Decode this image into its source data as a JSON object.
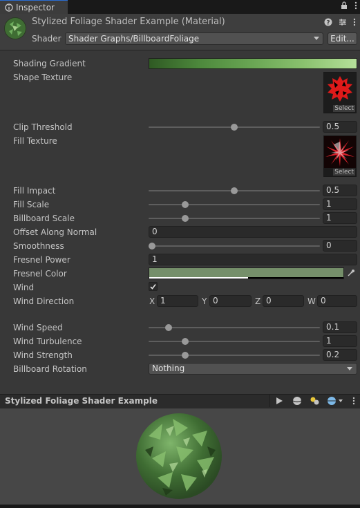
{
  "tab": {
    "title": "Inspector"
  },
  "header": {
    "title": "Stylized Foliage Shader Example (Material)",
    "shader_label": "Shader",
    "shader_value": "Shader Graphs/BillboardFoliage",
    "edit_label": "Edit..."
  },
  "props": {
    "shading_gradient": "Shading Gradient",
    "shape_texture": "Shape Texture",
    "clip_threshold": "Clip Threshold",
    "clip_threshold_value": "0.5",
    "fill_texture": "Fill Texture",
    "fill_impact": "Fill Impact",
    "fill_impact_value": "0.5",
    "fill_scale": "Fill Scale",
    "fill_scale_value": "1",
    "billboard_scale": "Billboard Scale",
    "billboard_scale_value": "1",
    "offset_along_normal": "Offset Along Normal",
    "offset_along_normal_value": "0",
    "smoothness": "Smoothness",
    "smoothness_value": "0",
    "fresnel_power": "Fresnel Power",
    "fresnel_power_value": "1",
    "fresnel_color": "Fresnel Color",
    "wind": "Wind",
    "wind_direction": "Wind Direction",
    "wind_x_label": "X",
    "wind_x": "1",
    "wind_y_label": "Y",
    "wind_y": "0",
    "wind_z_label": "Z",
    "wind_z": "0",
    "wind_w_label": "W",
    "wind_w": "0",
    "wind_speed": "Wind Speed",
    "wind_speed_value": "0.1",
    "wind_turbulence": "Wind Turbulence",
    "wind_turbulence_value": "1",
    "wind_strength": "Wind Strength",
    "wind_strength_value": "0.2",
    "billboard_rotation": "Billboard Rotation",
    "billboard_rotation_value": "Nothing",
    "select_label": "Select"
  },
  "slider_levels": {
    "clip_threshold": 0.5,
    "fill_impact": 0.5,
    "fill_scale": 0.2,
    "billboard_scale": 0.2,
    "smoothness": 0.0,
    "wind_speed": 0.1,
    "wind_turbulence": 0.2,
    "wind_strength": 0.2
  },
  "preview": {
    "title": "Stylized Foliage Shader Example"
  },
  "colors": {
    "fresnel_color": "#758f6a",
    "gradient_stops": [
      "#2f5a23",
      "#4e8a3d",
      "#6aa754",
      "#8bc26f",
      "#b5e09a"
    ],
    "accent": "#2a6dd3"
  },
  "icons": [
    "inspector-icon",
    "lock-icon",
    "more-icon",
    "help-icon",
    "preset-icon",
    "play-icon",
    "sphere-icon",
    "lighting-icon",
    "chevron-down-icon",
    "eyedropper-icon",
    "checkmark-icon"
  ]
}
